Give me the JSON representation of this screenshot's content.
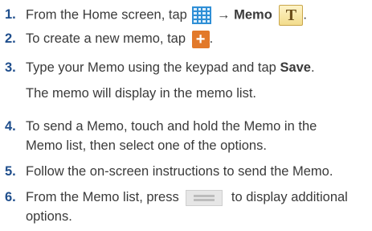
{
  "steps": [
    {
      "num": "1.",
      "pre": "From the Home screen, tap",
      "arrow": "→",
      "bold": "Memo",
      "icons": [
        "apps-grid-icon",
        "memo-app-icon"
      ],
      "memo_icon_letter": "T"
    },
    {
      "num": "2.",
      "pre": "To create a new memo, tap",
      "post": ".",
      "icons": [
        "add-plus-icon"
      ],
      "plus_glyph": "+"
    },
    {
      "num": "3.",
      "pre": "Type your Memo using the keypad and tap",
      "bold": "Save",
      "post": ".",
      "sub": "The memo will display in the memo list."
    },
    {
      "num": "4.",
      "line1": "To send a Memo, touch and hold the Memo in the",
      "line2": "Memo list, then select one of the options."
    },
    {
      "num": "5.",
      "text": "Follow the on-screen instructions to send the Memo."
    },
    {
      "num": "6.",
      "pre": "From the Memo list, press",
      "post": "to display additional",
      "line2": "options.",
      "icons": [
        "menu-key-icon"
      ]
    }
  ],
  "colors": {
    "step_number": "#1f4e8c",
    "body_text": "#3a3a3a",
    "grid_icon": "#2f8fd6",
    "plus_icon": "#e2792a",
    "memo_icon": "#f2dc8c"
  }
}
